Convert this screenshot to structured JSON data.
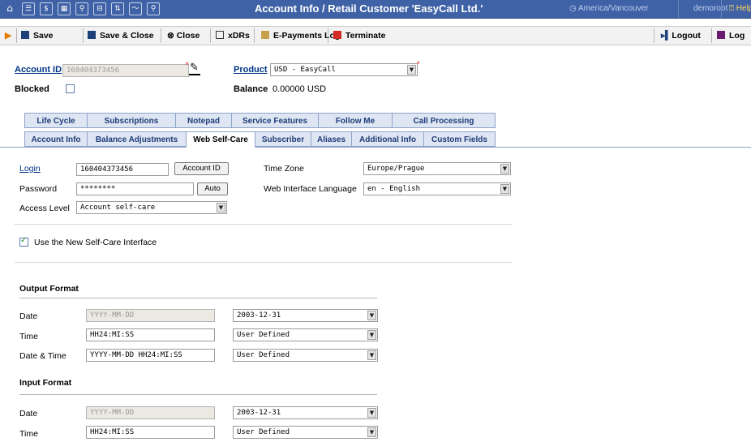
{
  "window": {
    "title": "Account Info / Retail Customer 'EasyCall Ltd.'",
    "timezone": "America/Vancouver",
    "user": "demoroot",
    "help": "Help"
  },
  "toolbar": {
    "save": "Save",
    "save_close": "Save & Close",
    "close": "Close",
    "xdrs": "xDRs",
    "epayments": "E-Payments Log",
    "terminate": "Terminate",
    "logout": "Logout",
    "log": "Log"
  },
  "header": {
    "account_id_label": "Account ID",
    "account_id_value": "160404373456",
    "product_label": "Product",
    "product_value": "USD - EasyCall",
    "blocked_label": "Blocked",
    "balance_label": "Balance",
    "balance_value": "0.00000 USD"
  },
  "tabs": {
    "row1": [
      "Life Cycle",
      "Subscriptions",
      "Notepad",
      "Service Features",
      "Follow Me",
      "Call Processing"
    ],
    "row2": [
      "Account Info",
      "Balance Adjustments",
      "Web Self-Care",
      "Subscriber",
      "Aliases",
      "Additional Info",
      "Custom Fields"
    ],
    "active": "Web Self-Care"
  },
  "form": {
    "login_label": "Login",
    "login_value": "160404373456",
    "account_id_button": "Account ID",
    "password_label": "Password",
    "password_value": "********",
    "auto_button": "Auto",
    "access_level_label": "Access Level",
    "access_level_value": "Account self-care",
    "time_zone_label": "Time Zone",
    "time_zone_value": "Europe/Prague",
    "web_lang_label": "Web Interface Language",
    "web_lang_value": "en - English",
    "new_selfcare_label": "Use the New Self-Care Interface",
    "new_selfcare_checked": true
  },
  "output_format": {
    "title": "Output Format",
    "rows": [
      {
        "label": "Date",
        "value": "YYYY-MM-DD",
        "disabled": true,
        "select": "2003-12-31"
      },
      {
        "label": "Time",
        "value": "HH24:MI:SS",
        "disabled": false,
        "select": "User Defined"
      },
      {
        "label": "Date & Time",
        "value": "YYYY-MM-DD HH24:MI:SS",
        "disabled": false,
        "select": "User Defined"
      }
    ]
  },
  "input_format": {
    "title": "Input Format",
    "rows": [
      {
        "label": "Date",
        "value": "YYYY-MM-DD",
        "disabled": true,
        "select": "2003-12-31"
      },
      {
        "label": "Time",
        "value": "HH24:MI:SS",
        "disabled": false,
        "select": "User Defined"
      }
    ]
  },
  "colors": {
    "topbar": "#3f62a6",
    "tab_bg": "#dfe6f3",
    "link": "#003388"
  }
}
